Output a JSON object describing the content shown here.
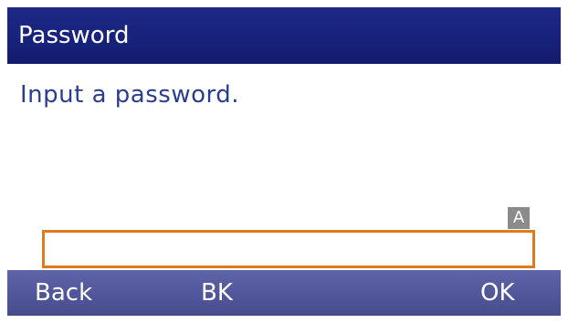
{
  "titlebar": {
    "title": "Password"
  },
  "body": {
    "prompt": "Input a password."
  },
  "input": {
    "mode_indicator": "A",
    "value": "",
    "border_color": "#e07a1a"
  },
  "softkeys": {
    "back_label": "Back",
    "bk_label": "BK",
    "ok_label": "OK"
  },
  "colors": {
    "titlebar": "#17217a",
    "softkey_bar": "#4f5598",
    "prompt_text": "#2b3d8f"
  }
}
